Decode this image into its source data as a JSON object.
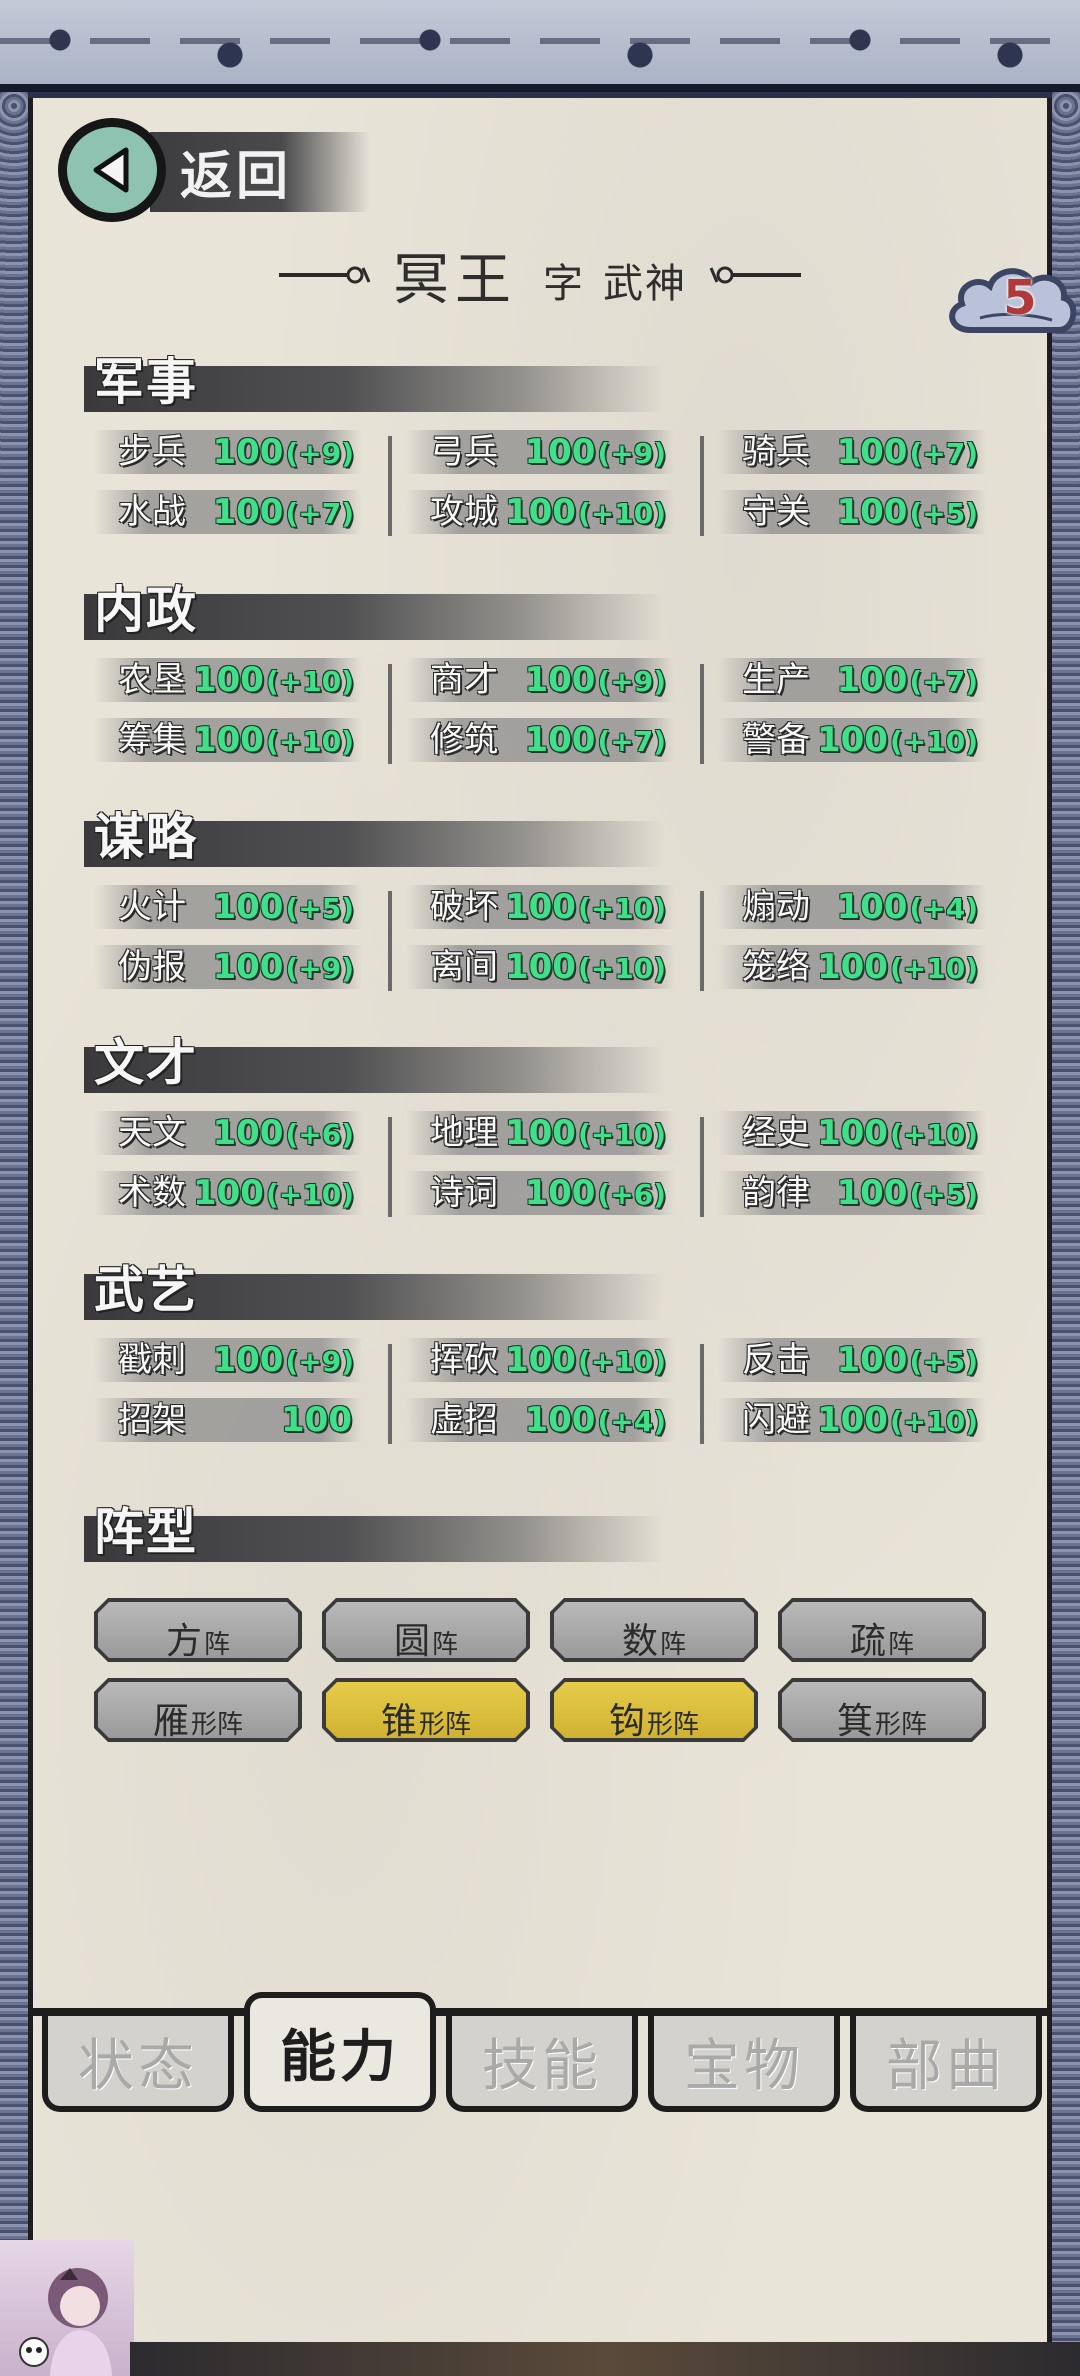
{
  "header": {
    "back_label": "返回",
    "char_name": "冥王",
    "courtesy_prefix": "字",
    "courtesy_name": "武神",
    "badge_number": "5"
  },
  "sections": [
    {
      "title": "军事",
      "stats": [
        {
          "name": "步兵",
          "value": "100",
          "bonus": "(+9)"
        },
        {
          "name": "弓兵",
          "value": "100",
          "bonus": "(+9)"
        },
        {
          "name": "骑兵",
          "value": "100",
          "bonus": "(+7)"
        },
        {
          "name": "水战",
          "value": "100",
          "bonus": "(+7)"
        },
        {
          "name": "攻城",
          "value": "100",
          "bonus": "(+10)"
        },
        {
          "name": "守关",
          "value": "100",
          "bonus": "(+5)"
        }
      ]
    },
    {
      "title": "内政",
      "stats": [
        {
          "name": "农垦",
          "value": "100",
          "bonus": "(+10)"
        },
        {
          "name": "商才",
          "value": "100",
          "bonus": "(+9)"
        },
        {
          "name": "生产",
          "value": "100",
          "bonus": "(+7)"
        },
        {
          "name": "筹集",
          "value": "100",
          "bonus": "(+10)"
        },
        {
          "name": "修筑",
          "value": "100",
          "bonus": "(+7)"
        },
        {
          "name": "警备",
          "value": "100",
          "bonus": "(+10)"
        }
      ]
    },
    {
      "title": "谋略",
      "stats": [
        {
          "name": "火计",
          "value": "100",
          "bonus": "(+5)"
        },
        {
          "name": "破坏",
          "value": "100",
          "bonus": "(+10)"
        },
        {
          "name": "煽动",
          "value": "100",
          "bonus": "(+4)"
        },
        {
          "name": "伪报",
          "value": "100",
          "bonus": "(+9)"
        },
        {
          "name": "离间",
          "value": "100",
          "bonus": "(+10)"
        },
        {
          "name": "笼络",
          "value": "100",
          "bonus": "(+10)"
        }
      ]
    },
    {
      "title": "文才",
      "stats": [
        {
          "name": "天文",
          "value": "100",
          "bonus": "(+6)"
        },
        {
          "name": "地理",
          "value": "100",
          "bonus": "(+10)"
        },
        {
          "name": "经史",
          "value": "100",
          "bonus": "(+10)"
        },
        {
          "name": "术数",
          "value": "100",
          "bonus": "(+10)"
        },
        {
          "name": "诗词",
          "value": "100",
          "bonus": "(+6)"
        },
        {
          "name": "韵律",
          "value": "100",
          "bonus": "(+5)"
        }
      ]
    },
    {
      "title": "武艺",
      "stats": [
        {
          "name": "戳刺",
          "value": "100",
          "bonus": "(+9)"
        },
        {
          "name": "挥砍",
          "value": "100",
          "bonus": "(+10)"
        },
        {
          "name": "反击",
          "value": "100",
          "bonus": "(+5)"
        },
        {
          "name": "招架",
          "value": "100",
          "bonus": ""
        },
        {
          "name": "虚招",
          "value": "100",
          "bonus": "(+4)"
        },
        {
          "name": "闪避",
          "value": "100",
          "bonus": "(+10)"
        }
      ]
    }
  ],
  "formation": {
    "title": "阵型",
    "items": [
      {
        "main": "方",
        "sub": "阵",
        "active": false
      },
      {
        "main": "圆",
        "sub": "阵",
        "active": false
      },
      {
        "main": "数",
        "sub": "阵",
        "active": false
      },
      {
        "main": "疏",
        "sub": "阵",
        "active": false
      },
      {
        "main": "雁",
        "sub": "形阵",
        "active": false
      },
      {
        "main": "锥",
        "sub": "形阵",
        "active": true
      },
      {
        "main": "钩",
        "sub": "形阵",
        "active": true
      },
      {
        "main": "箕",
        "sub": "形阵",
        "active": false
      }
    ],
    "active_color": "#d8bb38",
    "inactive_color": "#a8a8a8"
  },
  "tabs": [
    {
      "label": "状态",
      "active": false
    },
    {
      "label": "能力",
      "active": true
    },
    {
      "label": "技能",
      "active": false
    },
    {
      "label": "宝物",
      "active": false
    },
    {
      "label": "部曲",
      "active": false
    }
  ],
  "colors": {
    "stat_value": "#40e08a",
    "badge_number": "#b03a3a",
    "back_button": "#8fc3b1"
  }
}
